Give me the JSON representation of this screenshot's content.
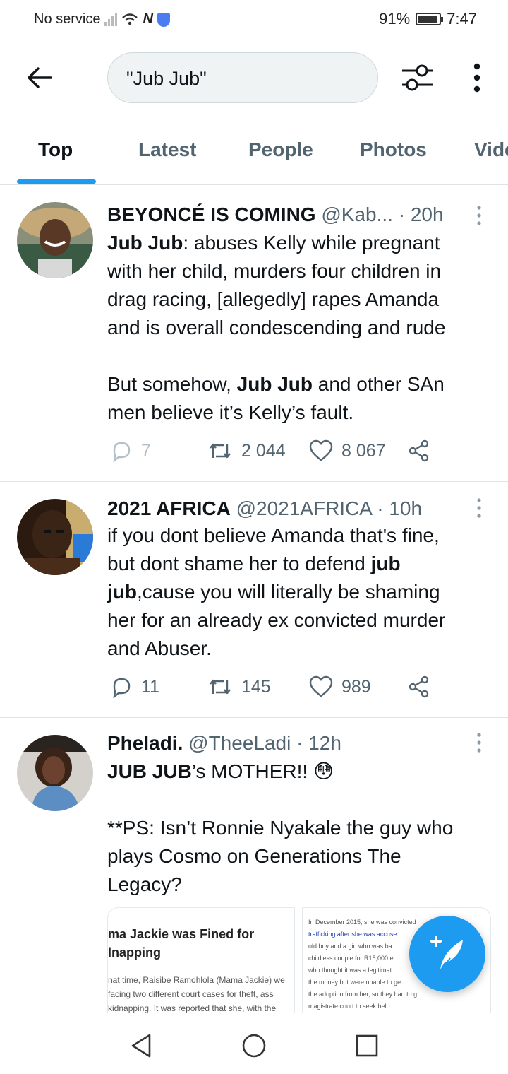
{
  "status_bar": {
    "carrier": "No service",
    "battery_percent": "91%",
    "battery_level": 0.91,
    "time": "7:47"
  },
  "search": {
    "query": "\"Jub Jub\""
  },
  "tabs": [
    {
      "label": "Top",
      "active": true
    },
    {
      "label": "Latest",
      "active": false
    },
    {
      "label": "People",
      "active": false
    },
    {
      "label": "Photos",
      "active": false
    },
    {
      "label": "Vide",
      "active": false
    }
  ],
  "tweets": [
    {
      "name": "BEYONCÉ IS COMING",
      "handle": "@Kab...",
      "time": "· 20h",
      "body_lines": [
        {
          "pre": "",
          "bold": "Jub Jub",
          "post": ": abuses Kelly while pregnant"
        },
        {
          "pre": "with her child, murders four children in",
          "bold": "",
          "post": ""
        },
        {
          "pre": "drag racing, [allegedly] rapes Amanda",
          "bold": "",
          "post": ""
        },
        {
          "pre": "and is overall condescending and rude",
          "bold": "",
          "post": ""
        },
        {
          "pre": "",
          "bold": "",
          "post": ""
        },
        {
          "pre": "But somehow, ",
          "bold": "Jub Jub",
          "post": " and other SAn"
        },
        {
          "pre": "men believe it’s Kelly’s fault.",
          "bold": "",
          "post": ""
        }
      ],
      "replies": "7",
      "retweets": "2 044",
      "likes": "8 067"
    },
    {
      "name": "2021 AFRICA",
      "handle": "@2021AFRICA",
      "time": "· 10h",
      "body_lines": [
        {
          "pre": "if you dont believe Amanda that's fine,",
          "bold": "",
          "post": ""
        },
        {
          "pre": "but dont shame her to defend ",
          "bold": "jub",
          "post": ""
        },
        {
          "pre": "",
          "bold": "jub",
          "post": ",cause you will literally be shaming"
        },
        {
          "pre": "her for an already ex convicted murder",
          "bold": "",
          "post": ""
        },
        {
          "pre": "and Abuser.",
          "bold": "",
          "post": ""
        }
      ],
      "replies": "11",
      "retweets": "145",
      "likes": "989"
    },
    {
      "name": "Pheladi.",
      "handle": "@TheeLadi",
      "time": "· 12h",
      "body_lines": [
        {
          "pre": "",
          "bold": "JUB JUB",
          "post": "’s MOTHER!! 😳"
        },
        {
          "pre": "",
          "bold": "",
          "post": ""
        },
        {
          "pre": "**PS: Isn’t Ronnie Nyakale the guy who",
          "bold": "",
          "post": ""
        },
        {
          "pre": "plays Cosmo on Generations The",
          "bold": "",
          "post": ""
        },
        {
          "pre": "Legacy?",
          "bold": "",
          "post": ""
        }
      ],
      "media": {
        "left_title_1": "ma Jackie was Fined for",
        "left_title_2": "lnapping",
        "left_text_1": "nat time, Raisibe Ramohlola (Mama Jackie) we",
        "left_text_2": "facing two different court cases for theft, ass",
        "left_text_3": "kidnapping. It was reported that she, with the",
        "right_text_1": "In December 2015, she was convicted",
        "right_text_2": "trafficking after she was accuse",
        "right_text_3": "old boy and a girl who was ba",
        "right_text_4": "childless couple for R15,000 e",
        "right_text_5": "who thought it was a legitimat",
        "right_text_6": "the money but were unable to ge",
        "right_text_7": "the adoption from her, so they had to g",
        "right_text_8": "magistrate court to seek help."
      }
    }
  ],
  "colors": {
    "accent": "#1d9bf0",
    "text": "#0f1419",
    "secondary": "#536471",
    "divider": "#dfe3e6"
  }
}
